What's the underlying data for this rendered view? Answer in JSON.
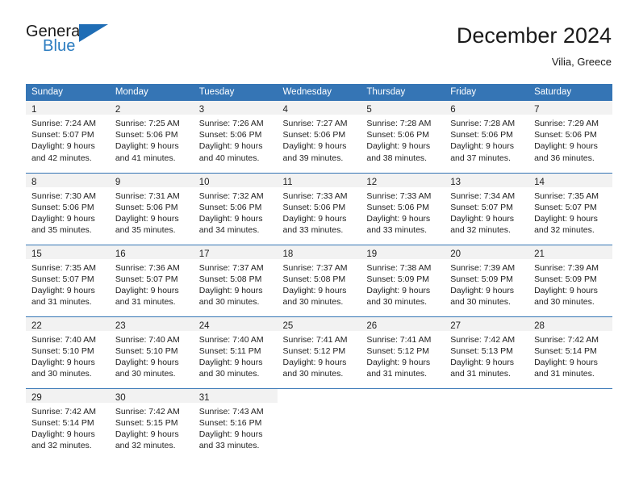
{
  "brand": {
    "name_part1": "General",
    "name_part2": "Blue",
    "accent_color": "#2b7cc0",
    "triangle_color": "#1f6db5",
    "triangle_icon": "triangle-icon"
  },
  "header": {
    "title": "December 2024",
    "subtitle": "Vilia, Greece"
  },
  "theme": {
    "header_blue": "#3575b5",
    "daynum_bg": "#f2f2f2",
    "text": "#222222"
  },
  "weekdays": [
    "Sunday",
    "Monday",
    "Tuesday",
    "Wednesday",
    "Thursday",
    "Friday",
    "Saturday"
  ],
  "weeks": [
    [
      {
        "day": "1",
        "sunrise": "Sunrise: 7:24 AM",
        "sunset": "Sunset: 5:07 PM",
        "daylight1": "Daylight: 9 hours",
        "daylight2": "and 42 minutes."
      },
      {
        "day": "2",
        "sunrise": "Sunrise: 7:25 AM",
        "sunset": "Sunset: 5:06 PM",
        "daylight1": "Daylight: 9 hours",
        "daylight2": "and 41 minutes."
      },
      {
        "day": "3",
        "sunrise": "Sunrise: 7:26 AM",
        "sunset": "Sunset: 5:06 PM",
        "daylight1": "Daylight: 9 hours",
        "daylight2": "and 40 minutes."
      },
      {
        "day": "4",
        "sunrise": "Sunrise: 7:27 AM",
        "sunset": "Sunset: 5:06 PM",
        "daylight1": "Daylight: 9 hours",
        "daylight2": "and 39 minutes."
      },
      {
        "day": "5",
        "sunrise": "Sunrise: 7:28 AM",
        "sunset": "Sunset: 5:06 PM",
        "daylight1": "Daylight: 9 hours",
        "daylight2": "and 38 minutes."
      },
      {
        "day": "6",
        "sunrise": "Sunrise: 7:28 AM",
        "sunset": "Sunset: 5:06 PM",
        "daylight1": "Daylight: 9 hours",
        "daylight2": "and 37 minutes."
      },
      {
        "day": "7",
        "sunrise": "Sunrise: 7:29 AM",
        "sunset": "Sunset: 5:06 PM",
        "daylight1": "Daylight: 9 hours",
        "daylight2": "and 36 minutes."
      }
    ],
    [
      {
        "day": "8",
        "sunrise": "Sunrise: 7:30 AM",
        "sunset": "Sunset: 5:06 PM",
        "daylight1": "Daylight: 9 hours",
        "daylight2": "and 35 minutes."
      },
      {
        "day": "9",
        "sunrise": "Sunrise: 7:31 AM",
        "sunset": "Sunset: 5:06 PM",
        "daylight1": "Daylight: 9 hours",
        "daylight2": "and 35 minutes."
      },
      {
        "day": "10",
        "sunrise": "Sunrise: 7:32 AM",
        "sunset": "Sunset: 5:06 PM",
        "daylight1": "Daylight: 9 hours",
        "daylight2": "and 34 minutes."
      },
      {
        "day": "11",
        "sunrise": "Sunrise: 7:33 AM",
        "sunset": "Sunset: 5:06 PM",
        "daylight1": "Daylight: 9 hours",
        "daylight2": "and 33 minutes."
      },
      {
        "day": "12",
        "sunrise": "Sunrise: 7:33 AM",
        "sunset": "Sunset: 5:06 PM",
        "daylight1": "Daylight: 9 hours",
        "daylight2": "and 33 minutes."
      },
      {
        "day": "13",
        "sunrise": "Sunrise: 7:34 AM",
        "sunset": "Sunset: 5:07 PM",
        "daylight1": "Daylight: 9 hours",
        "daylight2": "and 32 minutes."
      },
      {
        "day": "14",
        "sunrise": "Sunrise: 7:35 AM",
        "sunset": "Sunset: 5:07 PM",
        "daylight1": "Daylight: 9 hours",
        "daylight2": "and 32 minutes."
      }
    ],
    [
      {
        "day": "15",
        "sunrise": "Sunrise: 7:35 AM",
        "sunset": "Sunset: 5:07 PM",
        "daylight1": "Daylight: 9 hours",
        "daylight2": "and 31 minutes."
      },
      {
        "day": "16",
        "sunrise": "Sunrise: 7:36 AM",
        "sunset": "Sunset: 5:07 PM",
        "daylight1": "Daylight: 9 hours",
        "daylight2": "and 31 minutes."
      },
      {
        "day": "17",
        "sunrise": "Sunrise: 7:37 AM",
        "sunset": "Sunset: 5:08 PM",
        "daylight1": "Daylight: 9 hours",
        "daylight2": "and 30 minutes."
      },
      {
        "day": "18",
        "sunrise": "Sunrise: 7:37 AM",
        "sunset": "Sunset: 5:08 PM",
        "daylight1": "Daylight: 9 hours",
        "daylight2": "and 30 minutes."
      },
      {
        "day": "19",
        "sunrise": "Sunrise: 7:38 AM",
        "sunset": "Sunset: 5:09 PM",
        "daylight1": "Daylight: 9 hours",
        "daylight2": "and 30 minutes."
      },
      {
        "day": "20",
        "sunrise": "Sunrise: 7:39 AM",
        "sunset": "Sunset: 5:09 PM",
        "daylight1": "Daylight: 9 hours",
        "daylight2": "and 30 minutes."
      },
      {
        "day": "21",
        "sunrise": "Sunrise: 7:39 AM",
        "sunset": "Sunset: 5:09 PM",
        "daylight1": "Daylight: 9 hours",
        "daylight2": "and 30 minutes."
      }
    ],
    [
      {
        "day": "22",
        "sunrise": "Sunrise: 7:40 AM",
        "sunset": "Sunset: 5:10 PM",
        "daylight1": "Daylight: 9 hours",
        "daylight2": "and 30 minutes."
      },
      {
        "day": "23",
        "sunrise": "Sunrise: 7:40 AM",
        "sunset": "Sunset: 5:10 PM",
        "daylight1": "Daylight: 9 hours",
        "daylight2": "and 30 minutes."
      },
      {
        "day": "24",
        "sunrise": "Sunrise: 7:40 AM",
        "sunset": "Sunset: 5:11 PM",
        "daylight1": "Daylight: 9 hours",
        "daylight2": "and 30 minutes."
      },
      {
        "day": "25",
        "sunrise": "Sunrise: 7:41 AM",
        "sunset": "Sunset: 5:12 PM",
        "daylight1": "Daylight: 9 hours",
        "daylight2": "and 30 minutes."
      },
      {
        "day": "26",
        "sunrise": "Sunrise: 7:41 AM",
        "sunset": "Sunset: 5:12 PM",
        "daylight1": "Daylight: 9 hours",
        "daylight2": "and 31 minutes."
      },
      {
        "day": "27",
        "sunrise": "Sunrise: 7:42 AM",
        "sunset": "Sunset: 5:13 PM",
        "daylight1": "Daylight: 9 hours",
        "daylight2": "and 31 minutes."
      },
      {
        "day": "28",
        "sunrise": "Sunrise: 7:42 AM",
        "sunset": "Sunset: 5:14 PM",
        "daylight1": "Daylight: 9 hours",
        "daylight2": "and 31 minutes."
      }
    ],
    [
      {
        "day": "29",
        "sunrise": "Sunrise: 7:42 AM",
        "sunset": "Sunset: 5:14 PM",
        "daylight1": "Daylight: 9 hours",
        "daylight2": "and 32 minutes."
      },
      {
        "day": "30",
        "sunrise": "Sunrise: 7:42 AM",
        "sunset": "Sunset: 5:15 PM",
        "daylight1": "Daylight: 9 hours",
        "daylight2": "and 32 minutes."
      },
      {
        "day": "31",
        "sunrise": "Sunrise: 7:43 AM",
        "sunset": "Sunset: 5:16 PM",
        "daylight1": "Daylight: 9 hours",
        "daylight2": "and 33 minutes."
      },
      {
        "day": "",
        "sunrise": "",
        "sunset": "",
        "daylight1": "",
        "daylight2": ""
      },
      {
        "day": "",
        "sunrise": "",
        "sunset": "",
        "daylight1": "",
        "daylight2": ""
      },
      {
        "day": "",
        "sunrise": "",
        "sunset": "",
        "daylight1": "",
        "daylight2": ""
      },
      {
        "day": "",
        "sunrise": "",
        "sunset": "",
        "daylight1": "",
        "daylight2": ""
      }
    ]
  ]
}
